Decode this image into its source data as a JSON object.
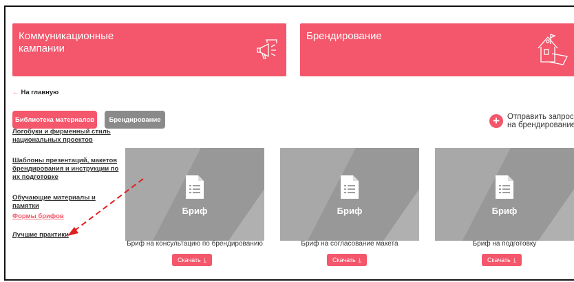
{
  "banners": [
    {
      "title": "Коммуникационные кампании",
      "icon": "megaphone-icon"
    },
    {
      "title": "Брендирование",
      "icon": "building-flag-icon"
    }
  ],
  "back_link": {
    "arrow": "←",
    "label": "На главную"
  },
  "tabs": [
    {
      "label": "Библиотека материалов",
      "active": true
    },
    {
      "label": "Брендирование",
      "active": false
    }
  ],
  "send_request": {
    "icon": "plus-icon",
    "label": "Отправить запрос на брендирование"
  },
  "sidebar": {
    "items": [
      {
        "label": "Логобуки и фирменный стиль национальных проектов"
      },
      {
        "label": "Шаблоны презентаций, макетов брендирования и инструкции по их подготовке"
      },
      {
        "label": "Обучающие материалы и памятки"
      },
      {
        "label": "Формы брифов",
        "active": true
      },
      {
        "label": "Лучшие практики"
      }
    ]
  },
  "cards": [
    {
      "thumb_label": "Бриф",
      "title": "Бриф на консультацию по брендированию",
      "button": "Скачать"
    },
    {
      "thumb_label": "Бриф",
      "title": "Бриф на согласование макета",
      "button": "Скачать"
    },
    {
      "thumb_label": "Бриф",
      "title": "Бриф на подготовку",
      "button": "Скачать"
    }
  ],
  "colors": {
    "accent": "#f4566b",
    "gray_pill": "#8a8a8a",
    "card_bg": "#9e9e9e",
    "annotation_arrow": "#e02020"
  }
}
